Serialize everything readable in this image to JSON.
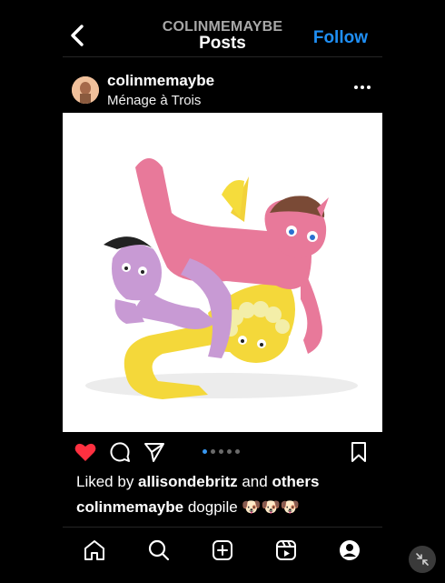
{
  "header": {
    "username": "COLINMEMAYBE",
    "title": "Posts",
    "follow_label": "Follow"
  },
  "post": {
    "username": "colinmemaybe",
    "location": "Ménage à Trois",
    "image_icon": "clay-sculpture-photo",
    "carousel": {
      "count": 5,
      "active_index": 0
    },
    "likes": {
      "prefix": "Liked by ",
      "liker": "allisondebritz",
      "middle": " and ",
      "others": "others"
    },
    "caption": {
      "username": "colinmemaybe",
      "text": "dogpile 🐶🐶🐶"
    },
    "liked": true
  },
  "nav": {
    "items": [
      "home-icon",
      "search-icon",
      "create-icon",
      "reels-icon",
      "profile-icon"
    ]
  },
  "colors": {
    "accent": "#1f8ff5",
    "like": "#ff3040",
    "background": "#000000"
  }
}
